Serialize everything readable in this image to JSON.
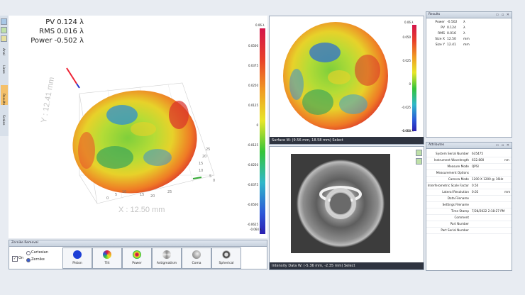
{
  "left_toolbar": {
    "tabs": [
      "Anal",
      "Lines",
      "Results",
      "Scales"
    ]
  },
  "main_view": {
    "overlay": {
      "pv": "PV 0.124 λ",
      "rms": "RMS 0.016 λ",
      "power": "Power -0.502 λ"
    },
    "axis_x_label": "X : 12.50 mm",
    "axis_y_label": "Y : 12.41 mm",
    "x_ticks": [
      "0",
      "5",
      "10",
      "15",
      "20",
      "25"
    ],
    "y_ticks": [
      "25",
      "20",
      "15",
      "10",
      "5",
      "0"
    ],
    "colorbar": {
      "top": "0.06 λ",
      "bottom": "-0.064 λ",
      "ticks": [
        "0.0500",
        "0.0375",
        "0.0250",
        "0.0125",
        "0",
        "-0.0125",
        "-0.0250",
        "-0.0375",
        "-0.0500",
        "-0.0625"
      ]
    }
  },
  "zernike": {
    "title": "Zernike Removal",
    "on_label": "On",
    "radio_cartesian": "Cartesian",
    "radio_zernike": "Zernike",
    "buttons": [
      "Piston",
      "Tilt",
      "Power",
      "Astigmatism",
      "Coma",
      "Spherical"
    ]
  },
  "surface_view": {
    "status": "Surface    W: (9.56 mm, 18.58 mm)    Select",
    "colorbar": {
      "top": "0.06 λ",
      "bottom": "-0.064 λ",
      "ticks": [
        "0.050",
        "0.025",
        "0",
        "-0.025",
        "-0.050"
      ]
    }
  },
  "intensity_view": {
    "status": "Intensity Data    W: (-5.36 mm, -2.35 mm)    Select"
  },
  "results": {
    "title": "Results",
    "rows": [
      {
        "label": "Power",
        "value": "-0.502",
        "unit": "λ"
      },
      {
        "label": "PV",
        "value": "0.124",
        "unit": "λ"
      },
      {
        "label": "RMS",
        "value": "0.016",
        "unit": "λ"
      },
      {
        "label": "Size X",
        "value": "12.50",
        "unit": "mm"
      },
      {
        "label": "Size Y",
        "value": "12.41",
        "unit": "mm"
      }
    ]
  },
  "attributes": {
    "title": "Attributes",
    "rows": [
      {
        "label": "System Serial Number",
        "value": "635475",
        "unit": ""
      },
      {
        "label": "Instrument Wavelength",
        "value": "632.800",
        "unit": "nm"
      },
      {
        "label": "Measure Mode",
        "value": "QPSI",
        "unit": ""
      },
      {
        "label": "Measurement Options",
        "value": "",
        "unit": ""
      },
      {
        "label": "Camera Mode",
        "value": "1200 X 1200 @ 16Hz",
        "unit": ""
      },
      {
        "label": "Interferometric Scale Factor",
        "value": "0.50",
        "unit": ""
      },
      {
        "label": "Lateral Resolution",
        "value": "0.02",
        "unit": "mm"
      },
      {
        "label": "Data Filename",
        "value": "",
        "unit": ""
      },
      {
        "label": "Settings Filename",
        "value": "",
        "unit": ""
      },
      {
        "label": "Time Stamp",
        "value": "7/28/2022 2:18:27 PM",
        "unit": ""
      },
      {
        "label": "Comment",
        "value": "",
        "unit": ""
      },
      {
        "label": "Part Number",
        "value": "",
        "unit": ""
      },
      {
        "label": "Part Serial Number",
        "value": "",
        "unit": ""
      }
    ]
  },
  "colors": {
    "status_bg": "#2f3440",
    "panel_header": "#c8d2de",
    "accent_blue": "#1d3fd6"
  }
}
